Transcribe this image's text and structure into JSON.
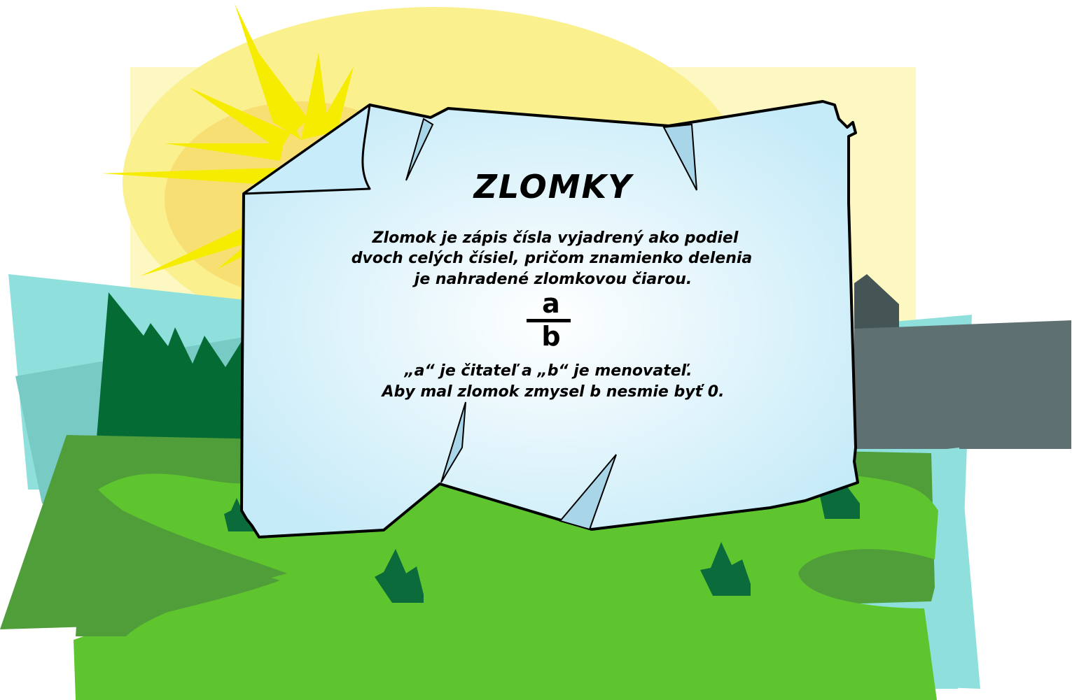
{
  "title": "ZLOMKY",
  "definition_lines": [
    "Zlomok je zápis čísla vyjadrený ako podiel",
    "dvoch celých čísiel, pričom znamienko delenia",
    "je nahradené zlomkovou čiarou."
  ],
  "fraction": {
    "numerator": "a",
    "denominator": "b"
  },
  "note_lines": [
    "„a“ je čitateľ a „b“ je menovateľ.",
    "Aby mal zlomok zmysel b nesmie byť 0."
  ],
  "colors": {
    "sun": "#f7ec00",
    "sky_pale": "#fdf8c0",
    "hill_teal": "#8ee0dc",
    "forest": "#046a34",
    "grass": "#5fc52e",
    "grass_dark": "#4f9d3a",
    "building": "#5f7072",
    "parchment": "#c8ecf8",
    "outline": "#000000"
  }
}
